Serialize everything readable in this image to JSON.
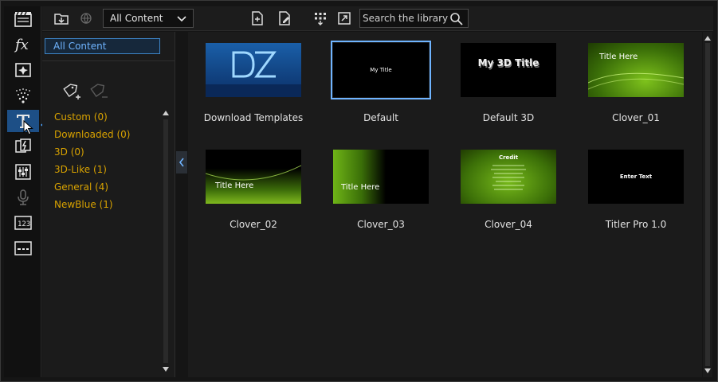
{
  "toolbar": {
    "content_filter": "All Content",
    "search_placeholder": "Search the library"
  },
  "tags": {
    "all_label": "All Content",
    "items": [
      {
        "label": "Custom  (0)"
      },
      {
        "label": "Downloaded  (0)"
      },
      {
        "label": "3D  (0)"
      },
      {
        "label": "3D-Like  (1)"
      },
      {
        "label": "General  (4)"
      },
      {
        "label": "NewBlue  (1)"
      }
    ]
  },
  "library": {
    "items": [
      {
        "label": "Download Templates",
        "thumb_text": "DZ"
      },
      {
        "label": "Default",
        "thumb_text": "My Title",
        "selected": true
      },
      {
        "label": "Default 3D",
        "thumb_text": "My 3D Title"
      },
      {
        "label": "Clover_01",
        "thumb_text": "Title Here"
      },
      {
        "label": "Clover_02",
        "thumb_text": "Title Here"
      },
      {
        "label": "Clover_03",
        "thumb_text": "Title Here"
      },
      {
        "label": "Clover_04",
        "thumb_text": "Credit"
      },
      {
        "label": "Titler Pro 1.0",
        "thumb_text": "Enter Text"
      }
    ]
  },
  "colors": {
    "accent": "#4aa3ff",
    "tag_text": "#d8a200",
    "selection_border": "#6fb4ff"
  },
  "icons": {
    "rooms": [
      "media-room-icon",
      "fx-icon",
      "pip-icon",
      "particle-icon",
      "title-icon",
      "transition-icon",
      "audio-mix-icon",
      "voiceover-icon",
      "chapter-icon",
      "subtitle-icon"
    ]
  }
}
